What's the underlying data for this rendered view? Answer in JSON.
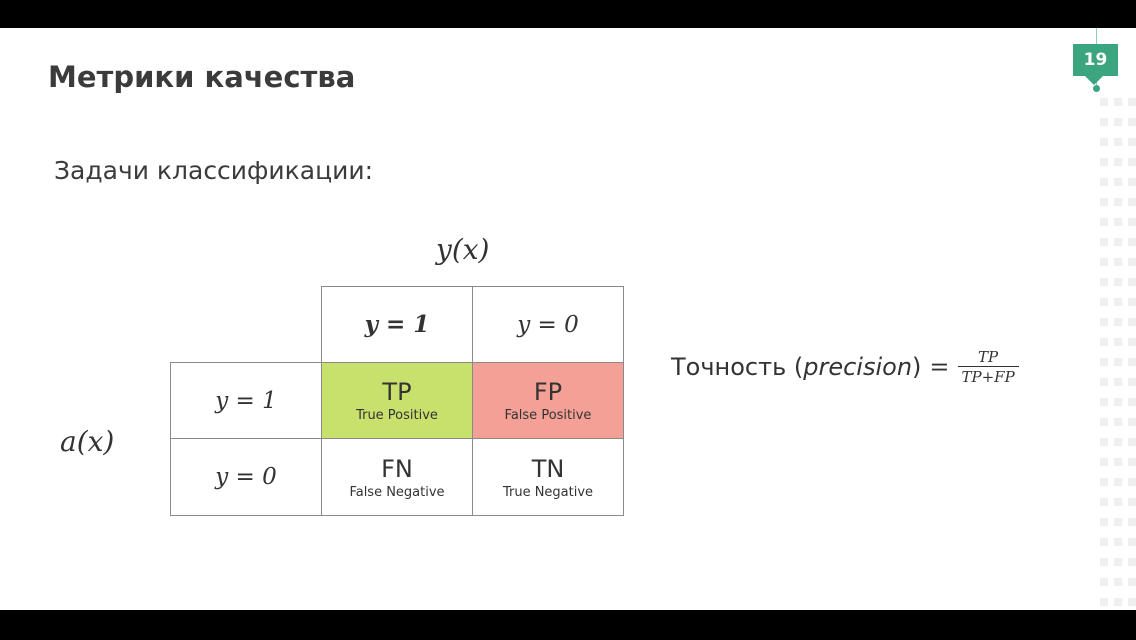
{
  "slide": {
    "title": "Метрики качества",
    "subtitle": "Задачи классификации:",
    "page_number": "19"
  },
  "matrix": {
    "col_axis_label": "y(x)",
    "row_axis_label": "a(x)",
    "col_headers": [
      "y = 1",
      "y = 0"
    ],
    "row_headers": [
      "y = 1",
      "y = 0"
    ],
    "cells": [
      [
        {
          "abbr": "TP",
          "full": "True Positive"
        },
        {
          "abbr": "FP",
          "full": "False Positive"
        }
      ],
      [
        {
          "abbr": "FN",
          "full": "False Negative"
        },
        {
          "abbr": "TN",
          "full": "True Negative"
        }
      ]
    ],
    "colors": {
      "tp": "#c8e06c",
      "fp": "#f4a096"
    }
  },
  "formula": {
    "label": "Точность",
    "paren_open": "(",
    "term": "precision",
    "paren_close": ")",
    "equals": "=",
    "numerator": "TP",
    "denominator": "TP+FP"
  },
  "theme": {
    "accent": "#3aa57f"
  }
}
